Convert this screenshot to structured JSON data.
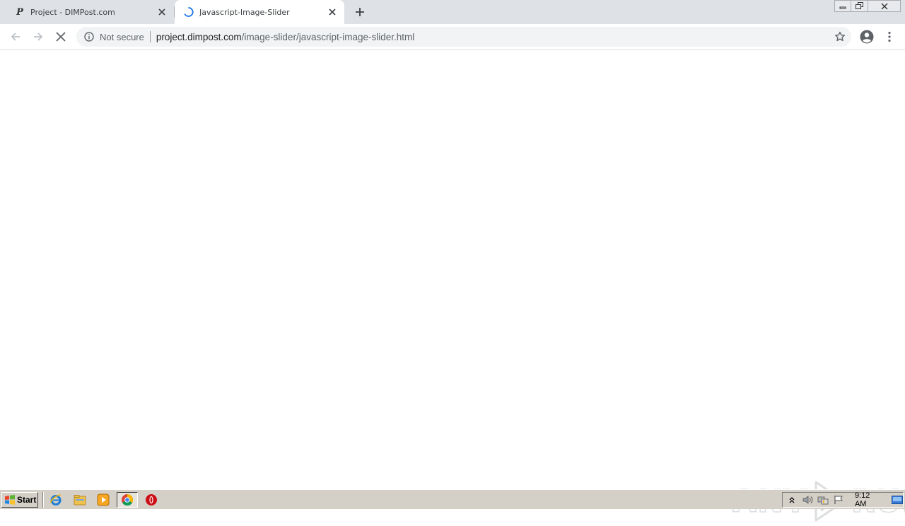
{
  "browser": {
    "tabs": [
      {
        "title": "Project - DIMPost.com",
        "favicon": "P",
        "active": false
      },
      {
        "title": "Javascript-Image-Slider",
        "favicon": "loading-spinner-icon",
        "active": true
      }
    ],
    "security_label": "Not secure",
    "url_host": "project.dimpost.com",
    "url_path": "/image-slider/javascript-image-slider.html",
    "icons": [
      "back-icon",
      "forward-icon",
      "stop-icon",
      "info-icon",
      "star-icon",
      "profile-icon",
      "menu-icon",
      "new-tab-icon",
      "close-icon"
    ]
  },
  "watermark": {
    "text_left": "ANY",
    "text_right": "RUN"
  },
  "taskbar": {
    "start_label": "Start",
    "quick_launch": [
      "ie-icon",
      "explorer-icon",
      "media-player-icon",
      "chrome-icon",
      "opera-icon"
    ],
    "tray_icons": [
      "tray-expand-icon",
      "volume-icon",
      "network-icon",
      "action-center-flag-icon",
      "show-desktop-icon"
    ],
    "clock": "9:12 AM"
  },
  "colors": {
    "tabstrip_bg": "#dee1e6",
    "omnibox_bg": "#f1f3f4",
    "taskbar_bg": "#d4d0c8",
    "spinner": "#1a73e8"
  }
}
